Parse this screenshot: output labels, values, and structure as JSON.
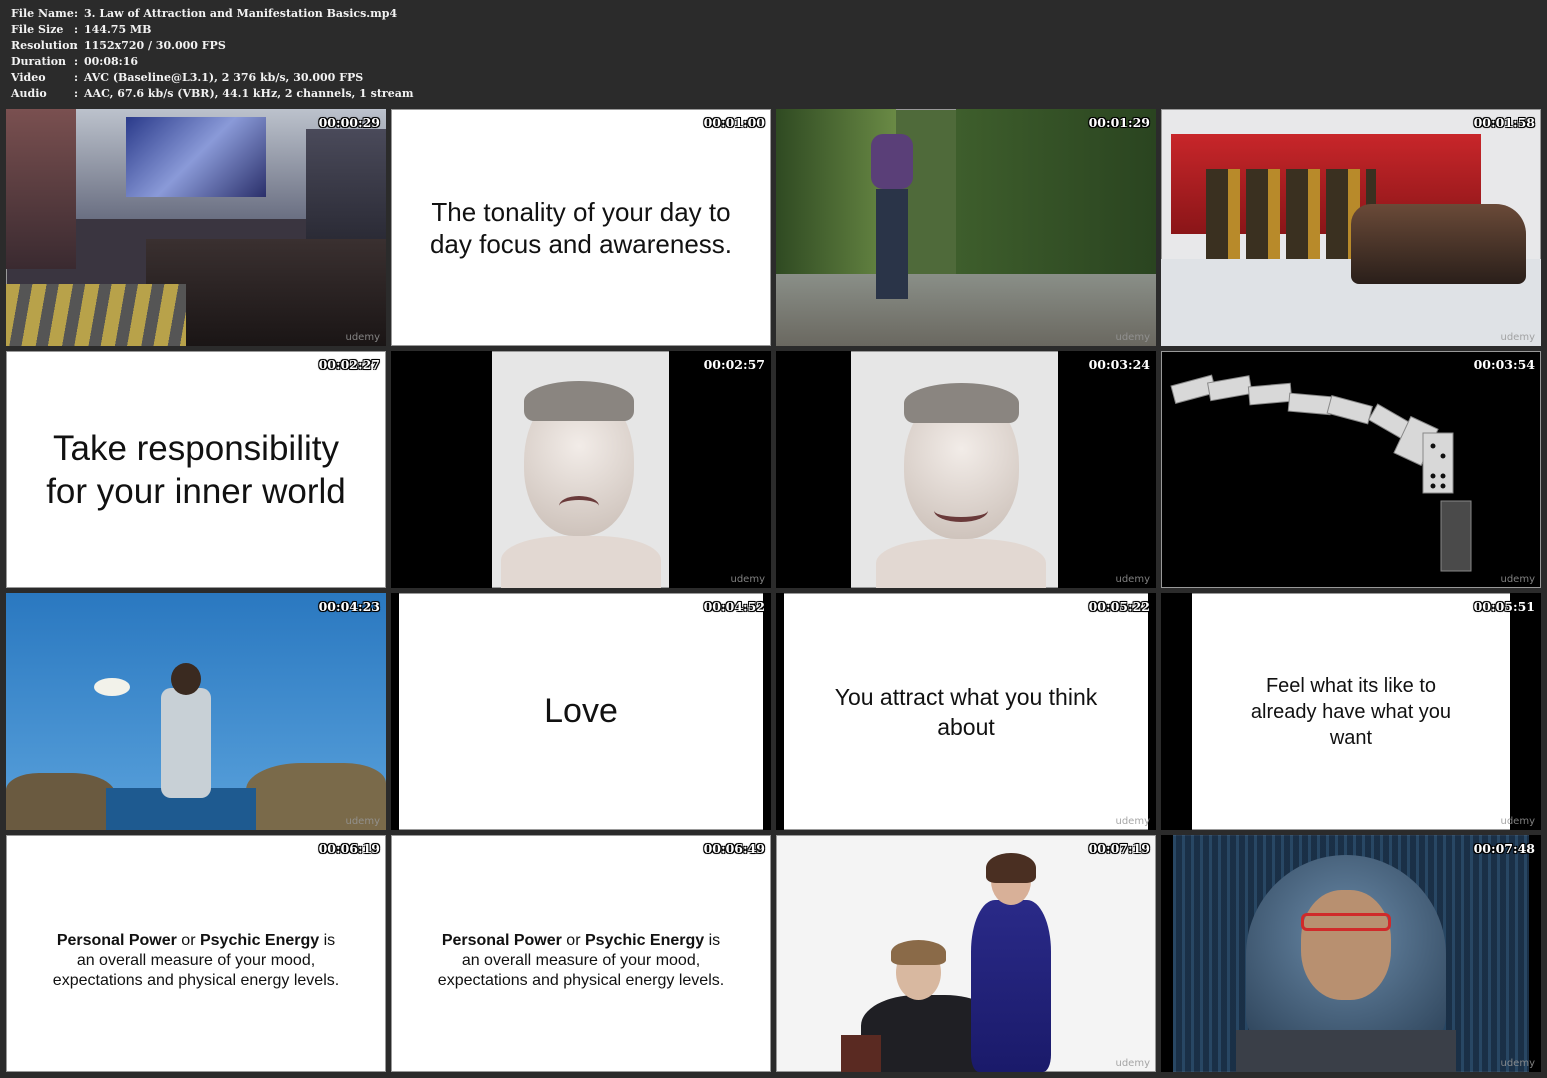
{
  "info": [
    {
      "key": "File Name",
      "value": "3. Law of Attraction and Manifestation Basics.mp4"
    },
    {
      "key": "File Size",
      "value": "144.75 MB"
    },
    {
      "key": "Resolution",
      "value": "1152x720 / 30.000 FPS"
    },
    {
      "key": "Duration",
      "value": "00:08:16"
    },
    {
      "key": "Video",
      "value": "AVC (Baseline@L3.1), 2 376 kb/s, 30.000 FPS"
    },
    {
      "key": "Audio",
      "value": "AAC, 67.6 kb/s (VBR), 44.1 kHz, 2 channels, 1 stream"
    }
  ],
  "info_separator": ":",
  "watermark": "udemy",
  "thumbs": [
    {
      "time": "00:00:29",
      "scene": "city-street-photo"
    },
    {
      "time": "00:01:00",
      "scene": "text-slide",
      "text_lines": [
        "The tonality of your day to",
        "day focus and awareness."
      ]
    },
    {
      "time": "00:01:29",
      "scene": "hiker-canyon-photo"
    },
    {
      "time": "00:01:58",
      "scene": "firefighters-photo"
    },
    {
      "time": "00:02:27",
      "scene": "text-slide",
      "text_lines": [
        "Take responsibility",
        "for your inner world"
      ]
    },
    {
      "time": "00:02:57",
      "scene": "sad-face-photo"
    },
    {
      "time": "00:03:24",
      "scene": "happy-face-photo"
    },
    {
      "time": "00:03:54",
      "scene": "dominoes-photo"
    },
    {
      "time": "00:04:23",
      "scene": "woman-sea-photo"
    },
    {
      "time": "00:04:52",
      "scene": "text-slide",
      "text_lines": [
        "Love"
      ]
    },
    {
      "time": "00:05:22",
      "scene": "text-slide",
      "text_lines": [
        "You attract what you think",
        "about"
      ]
    },
    {
      "time": "00:05:51",
      "scene": "text-slide",
      "text_lines": [
        "Feel what its like to",
        "already have what you",
        "want"
      ]
    },
    {
      "time": "00:06:19",
      "scene": "text-slide",
      "rich": {
        "b1": "Personal Power",
        "mid": " or ",
        "b2": "Psychic Energy",
        "tail": " is",
        "line2": "an overall measure of your mood,",
        "line3": "expectations and physical energy levels."
      }
    },
    {
      "time": "00:06:49",
      "scene": "text-slide",
      "rich": {
        "b1": "Personal Power",
        "mid": " or ",
        "b2": "Psychic Energy",
        "tail": " is",
        "line2": "an overall measure of your mood,",
        "line3": "expectations and physical energy levels."
      }
    },
    {
      "time": "00:07:19",
      "scene": "couple-photo"
    },
    {
      "time": "00:07:48",
      "scene": "hacker-photo"
    }
  ]
}
